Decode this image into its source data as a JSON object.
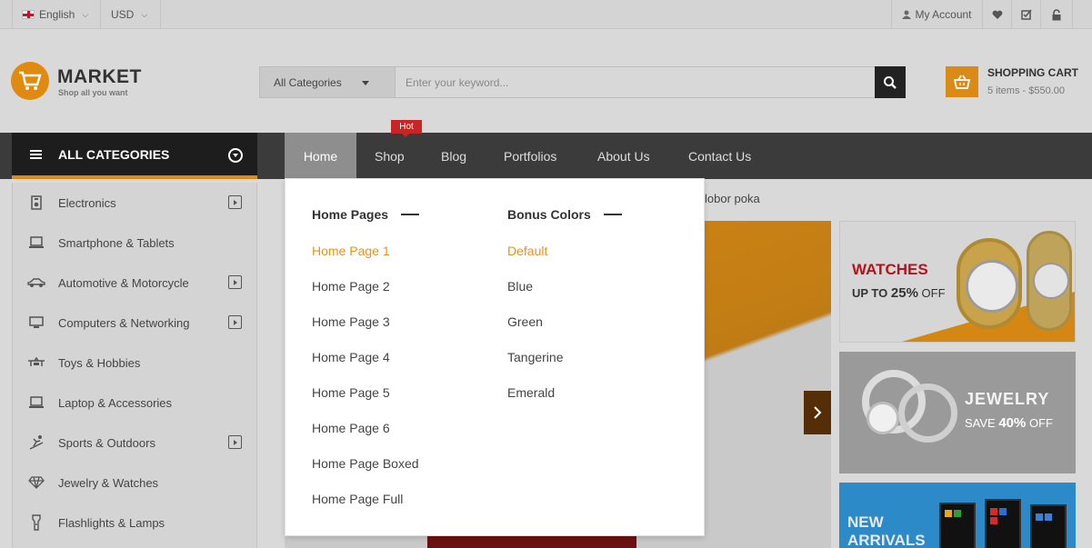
{
  "topbar": {
    "language": "English",
    "currency": "USD",
    "my_account": "My Account"
  },
  "header": {
    "logo_title": "MARKET",
    "logo_tagline": "Shop all you want",
    "search_category": "All Categories",
    "search_placeholder": "Enter your keyword...",
    "cart_title": "SHOPPING CART",
    "cart_summary": "5 items - $550.00"
  },
  "nav": {
    "all_categories": "ALL CATEGORIES",
    "items": [
      "Home",
      "Shop",
      "Blog",
      "Portfolios",
      "About Us",
      "Contact Us"
    ],
    "hot_badge": "Hot",
    "active_index": 0
  },
  "sidebar": {
    "items": [
      {
        "label": "Electronics",
        "icon": "speaker-icon",
        "has_submenu": true
      },
      {
        "label": "Smartphone & Tablets",
        "icon": "laptop-icon",
        "has_submenu": false
      },
      {
        "label": "Automotive & Motorcycle",
        "icon": "car-icon",
        "has_submenu": true
      },
      {
        "label": "Computers & Networking",
        "icon": "monitor-icon",
        "has_submenu": true
      },
      {
        "label": "Toys & Hobbies",
        "icon": "toy-icon",
        "has_submenu": false
      },
      {
        "label": "Laptop & Accessories",
        "icon": "laptop-icon",
        "has_submenu": false
      },
      {
        "label": "Sports & Outdoors",
        "icon": "ski-icon",
        "has_submenu": true
      },
      {
        "label": "Jewelry & Watches",
        "icon": "diamond-icon",
        "has_submenu": false
      },
      {
        "label": "Flashlights & Lamps",
        "icon": "flashlight-icon",
        "has_submenu": false
      }
    ]
  },
  "dropdown": {
    "col1_title": "Home Pages",
    "col1_links": [
      "Home Page 1",
      "Home Page 2",
      "Home Page 3",
      "Home Page 4",
      "Home Page 5",
      "Home Page 6",
      "Home Page Boxed",
      "Home Page Full"
    ],
    "col2_title": "Bonus Colors",
    "col2_links": [
      "Default",
      "Blue",
      "Green",
      "Tangerine",
      "Emerald"
    ],
    "highlight_color": "#e8921f"
  },
  "content": {
    "marquee_text": "lobor poka",
    "banner_watches_title": "WATCHES",
    "banner_watches_sub": "UP TO",
    "banner_watches_pct": "25%",
    "banner_watches_off": "OFF",
    "banner_jewelry_title": "JEWELRY",
    "banner_jewelry_sub": "SAVE",
    "banner_jewelry_pct": "40%",
    "banner_jewelry_off": "OFF",
    "banner_new_line1": "NEW",
    "banner_new_line2": "ARRIVALS"
  },
  "colors": {
    "accent": "#d98a17",
    "nav_bg": "#3b3b3b",
    "hot": "#c82626"
  }
}
